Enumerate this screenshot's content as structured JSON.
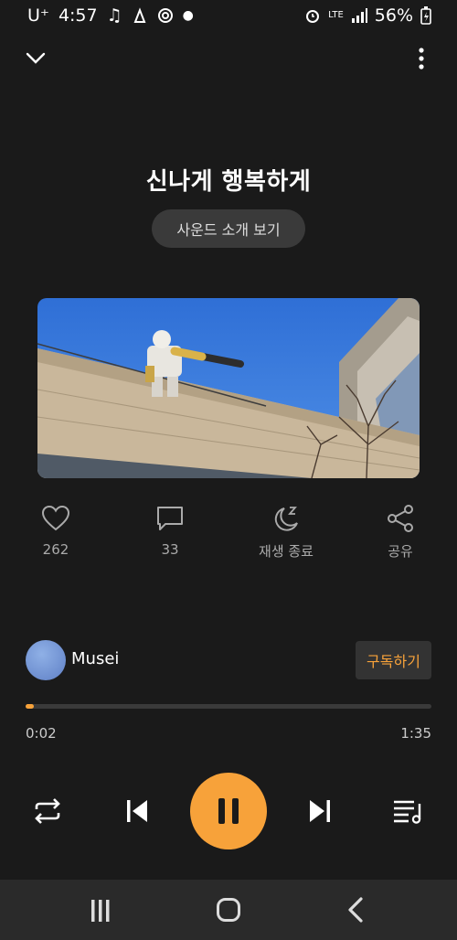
{
  "status_bar": {
    "carrier": "U⁺",
    "time": "4:57",
    "network": "LTE",
    "battery": "56%"
  },
  "track": {
    "title": "신나게 행복하게",
    "sound_intro_label": "사운드 소개 보기"
  },
  "actions": {
    "likes": "262",
    "comments": "33",
    "sleep_timer_label": "재생 종료",
    "share_label": "공유"
  },
  "artist": {
    "name": "Musei",
    "subscribe_label": "구독하기"
  },
  "playback": {
    "elapsed": "0:02",
    "duration": "1:35",
    "progress_fraction": 0.021
  },
  "colors": {
    "accent": "#f7a23a",
    "background": "#1a1a1a"
  }
}
